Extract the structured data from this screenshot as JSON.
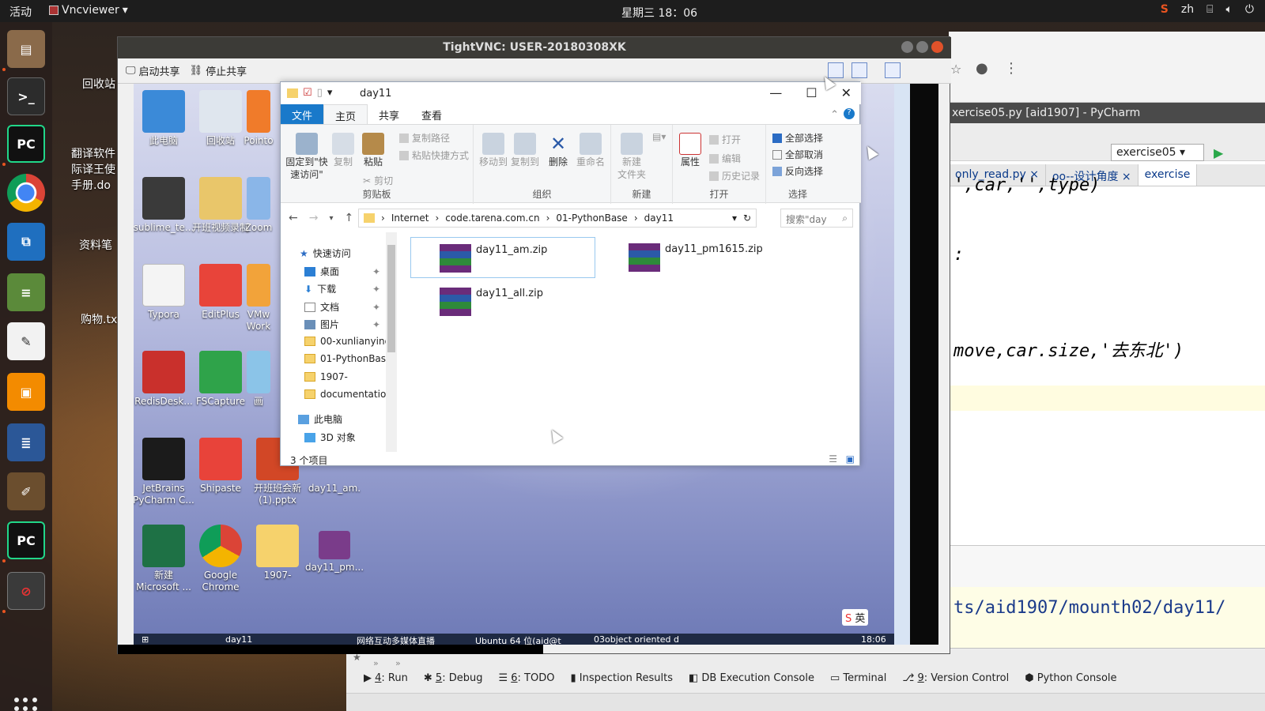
{
  "topbar": {
    "activities": "活动",
    "app": "Vncviewer",
    "clock": "星期三 18：06",
    "lang": "zh"
  },
  "ubuntu_desktop": {
    "trash": "回收站",
    "doc1": "翻译软件\n际译王使\n手册.do",
    "folder1": "资料笔",
    "txt": "购物.tx"
  },
  "vnc": {
    "title": "TightVNC: USER-20180308XK",
    "start_share": "启动共享",
    "stop_share": "停止共享"
  },
  "remote_icons": [
    {
      "label": "此电脑",
      "color": "#3b8ad8"
    },
    {
      "label": "回收站",
      "color": "#dfe6ee"
    },
    {
      "label": "Pointo",
      "color": "#f07b2a"
    },
    {
      "label": "sublime_te...",
      "color": "#3a3a3a"
    },
    {
      "label": "开班视频录制",
      "color": "#e9c66a"
    },
    {
      "label": "Zoom",
      "color": "#8ab6e8"
    },
    {
      "label": "Typora",
      "color": "#f4f4f4"
    },
    {
      "label": "EditPlus",
      "color": "#e8443a"
    },
    {
      "label": "VMw\nWork",
      "color": "#f2a33a"
    },
    {
      "label": "RedisDesk...",
      "color": "#c9302c"
    },
    {
      "label": "FSCapture",
      "color": "#2fa34a"
    },
    {
      "label": "画",
      "color": "#8bc4e8"
    },
    {
      "label": "JetBrains\nPyCharm C...",
      "color": "#1b1b1b"
    },
    {
      "label": "Shipaste",
      "color": "#e8433a"
    },
    {
      "label": "开班班会新\n(1).pptx",
      "color": "#d24726"
    },
    {
      "label": "day11_am.",
      "color": "#b7b7c9"
    },
    {
      "label": "新建\nMicrosoft ...",
      "color": "#1e7145"
    },
    {
      "label": "Google\nChrome",
      "color": "#db4437"
    },
    {
      "label": "1907-",
      "color": "#f6d26c"
    },
    {
      "label": "day11_pm...",
      "color": "#7a3c8a"
    }
  ],
  "remote_taskbar": {
    "item1": "day11",
    "item2": "网络互动多媒体直播",
    "item3": "Ubuntu 64 位(aid@t",
    "item4": "03object oriented d",
    "time": "18:06"
  },
  "ime_badge": "英",
  "explorer": {
    "title": "day11",
    "tabs": [
      "文件",
      "主页",
      "共享",
      "查看"
    ],
    "ribbon": {
      "pin": "固定到\"快\n速访问\"",
      "copy": "复制",
      "paste": "粘贴",
      "copy_path": "复制路径",
      "paste_shortcut": "粘贴快捷方式",
      "cut": "剪切",
      "group_clipboard": "剪贴板",
      "move_to": "移动到",
      "copy_to": "复制到",
      "delete": "删除",
      "rename": "重命名",
      "group_organize": "组织",
      "new_folder": "新建\n文件夹",
      "group_new": "新建",
      "properties": "属性",
      "open": "打开",
      "edit": "编辑",
      "history": "历史记录",
      "group_open": "打开",
      "select_all": "全部选择",
      "select_none": "全部取消",
      "invert": "反向选择",
      "group_select": "选择"
    },
    "breadcrumb": [
      "Internet",
      "code.tarena.com.cn",
      "01-PythonBase",
      "day11"
    ],
    "search_placeholder": "搜索\"day",
    "nav": {
      "quick": "快速访问",
      "desktop": "桌面",
      "downloads": "下载",
      "docs": "文档",
      "pictures": "图片",
      "f1": "00-xunlianying",
      "f2": "01-PythonBase",
      "f3": "1907-",
      "f4": "documentation",
      "pc": "此电脑",
      "obj3d": "3D 对象"
    },
    "files": [
      {
        "name": "day11_am.zip"
      },
      {
        "name": "day11_pm1615.zip"
      },
      {
        "name": "day11_all.zip"
      }
    ],
    "status": "3 个项目"
  },
  "pycharm": {
    "title": "xercise05.py [aid1907] - PyCharm",
    "run_config": "exercise05",
    "tabs": [
      {
        "label": "only_read.py"
      },
      {
        "label": "oo--设计角度"
      },
      {
        "label": "exercise"
      }
    ],
    "code_line1": "',car,'',type)",
    "code_line2": ":",
    "code_line3": "move,car.size,'去东北')",
    "path_text": "ts/aid1907/mounth02/day11/"
  },
  "toolwindows": [
    {
      "num": "4",
      "label": ": Run"
    },
    {
      "num": "5",
      "label": ": Debug"
    },
    {
      "num": "6",
      "label": ": TODO"
    },
    {
      "num": "",
      "label": "Inspection Results"
    },
    {
      "num": "",
      "label": "DB Execution Console"
    },
    {
      "num": "",
      "label": "Terminal"
    },
    {
      "num": "9",
      "label": ": Version Control"
    },
    {
      "num": "",
      "label": "Python Console"
    }
  ],
  "colors": {
    "accent": "#1979ca",
    "ubuntu_orange": "#e95420"
  }
}
